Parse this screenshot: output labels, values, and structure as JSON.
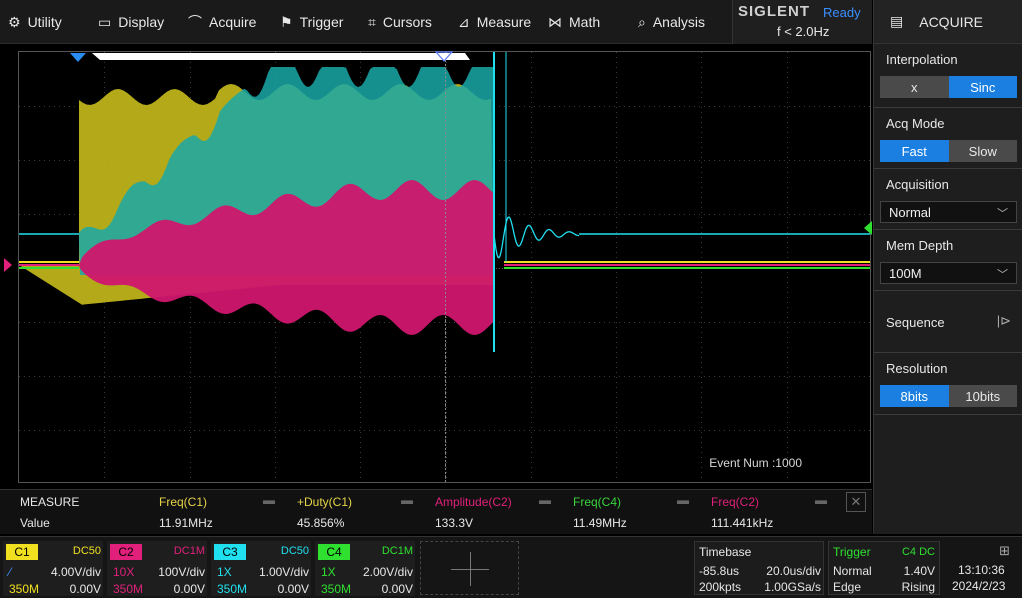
{
  "menu": [
    {
      "label": "Utility",
      "icon": "gear-icon",
      "glyph": "⚙"
    },
    {
      "label": "Display",
      "icon": "display-icon",
      "glyph": "🖵"
    },
    {
      "label": "Acquire",
      "icon": "acquire-icon",
      "glyph": "⌒"
    },
    {
      "label": "Trigger",
      "icon": "trigger-flag-icon",
      "glyph": "⚑"
    },
    {
      "label": "Cursors",
      "icon": "cursor-crosshair-icon",
      "glyph": "⌗"
    },
    {
      "label": "Measure",
      "icon": "measure-icon",
      "glyph": "⊿"
    },
    {
      "label": "Math",
      "icon": "math-icon",
      "glyph": "⋈"
    },
    {
      "label": "Analysis",
      "icon": "analysis-icon",
      "glyph": "⌕"
    }
  ],
  "brand": {
    "logo": "SIGLENT",
    "status": "Ready",
    "trigger_freq": "f < 2.0Hz"
  },
  "panel": {
    "title": "ACQUIRE",
    "interpolation": {
      "label": "Interpolation",
      "options": [
        "x",
        "Sinc"
      ],
      "selected": "Sinc"
    },
    "acq_mode": {
      "label": "Acq Mode",
      "options": [
        "Fast",
        "Slow"
      ],
      "selected": "Fast"
    },
    "acquisition": {
      "label": "Acquisition",
      "value": "Normal"
    },
    "mem_depth": {
      "label": "Mem Depth",
      "value": "100M"
    },
    "sequence": {
      "label": "Sequence"
    },
    "resolution": {
      "label": "Resolution",
      "options": [
        "8bits",
        "10bits"
      ],
      "selected": "8bits"
    }
  },
  "screen": {
    "event_num": "Event Num :1000"
  },
  "measure": {
    "header_label": "MEASURE",
    "value_label": "Value",
    "items": [
      {
        "name": "Freq(C1)",
        "value": "11.91MHz",
        "color": "#e6d44a"
      },
      {
        "name": "+Duty(C1)",
        "value": "45.856%",
        "color": "#e6d44a"
      },
      {
        "name": "Amplitude(C2)",
        "value": "133.3V",
        "color": "#e0207a"
      },
      {
        "name": "Freq(C4)",
        "value": "11.49MHz",
        "color": "#39d43a"
      },
      {
        "name": "Freq(C2)",
        "value": "111.441kHz",
        "color": "#e0207a"
      }
    ]
  },
  "channels": [
    {
      "id": "C1",
      "coupling": "DC50",
      "probe": "",
      "scale": "4.00V/div",
      "bw": "350M",
      "offset": "0.00V",
      "color": "#f0e020"
    },
    {
      "id": "C2",
      "coupling": "DC1M",
      "probe": "10X",
      "scale": "100V/div",
      "bw": "350M",
      "offset": "0.00V",
      "color": "#e0207a"
    },
    {
      "id": "C3",
      "coupling": "DC50",
      "probe": "1X",
      "scale": "1.00V/div",
      "bw": "350M",
      "offset": "0.00V",
      "color": "#20e0f0"
    },
    {
      "id": "C4",
      "coupling": "DC1M",
      "probe": "1X",
      "scale": "2.00V/div",
      "bw": "350M",
      "offset": "0.00V",
      "color": "#30e030"
    }
  ],
  "timebase": {
    "label": "Timebase",
    "delay": "-85.8us",
    "scale": "20.0us/div",
    "points": "200kpts",
    "rate": "1.00GSa/s"
  },
  "trigger": {
    "label": "Trigger",
    "source": "C4 DC",
    "mode": "Normal",
    "level": "1.40V",
    "type": "Edge",
    "slope": "Rising"
  },
  "clock": {
    "time": "13:10:36",
    "date": "2024/2/23"
  },
  "colors": {
    "accent": "#1a7fe0",
    "c1": "#c8bc1c",
    "c2": "#d0166e",
    "c3": "#1aa8a8",
    "c4": "#30e030"
  }
}
